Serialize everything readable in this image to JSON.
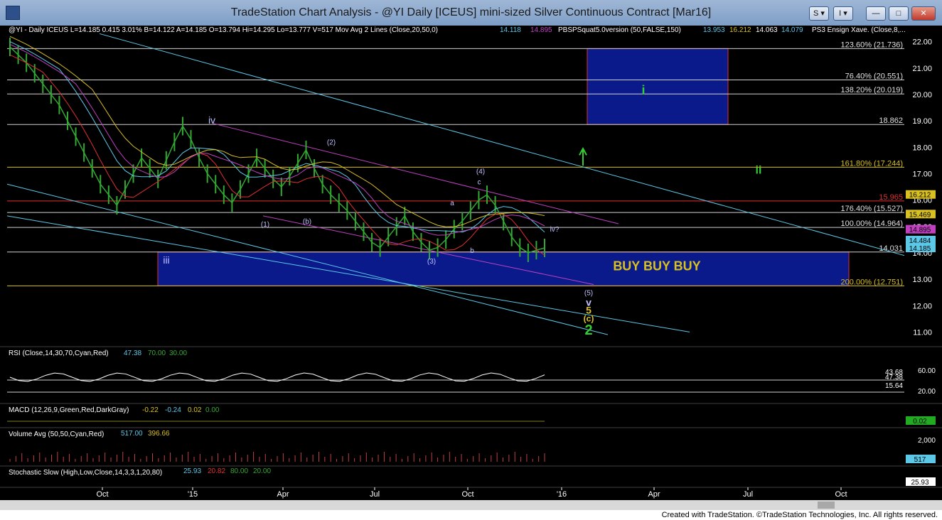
{
  "window": {
    "title": "TradeStation Chart Analysis - @YI Daily [ICEUS] mini-sized Silver Continuous Contract [Mar16]",
    "buttons": {
      "s": "S ▾",
      "i": "I ▾",
      "min": "—",
      "max": "□",
      "close": "✕"
    }
  },
  "footer": "Created with TradeStation. ©TradeStation Technologies, Inc. All rights reserved.",
  "colors": {
    "bg": "#000000",
    "bars": "#33a833",
    "cyan": "#5bc8e8",
    "magenta": "#c040c0",
    "yellow": "#d8c020",
    "red": "#e03030",
    "blue_box": "#0a1a8a",
    "green": "#22aa22"
  },
  "chart_data": {
    "type": "line",
    "title": "@YI Daily [ICEUS] mini-sized Silver Continuous Contract [Mar16]",
    "header_line": "@YI - Daily  ICEUS  L=14.185  0.415  3.01%  B=14.122  A=14.185  O=13.794  Hi=14.295  Lo=13.777  V=517  Mov Avg 2 Lines (Close,20,50,0)",
    "ma_values": [
      "14.118",
      "14.895"
    ],
    "pbs_label": "PBSPSquat5.0version (50,FALSE,150)",
    "pbs_values": [
      "13.953",
      "16.212",
      "14.063",
      "14.079"
    ],
    "ps3_label": "PS3 Ensign Xave. (Close,8,...",
    "x_ticks": [
      "Oct",
      "'15",
      "Apr",
      "Jul",
      "Oct",
      "'16",
      "Apr",
      "Jul",
      "Oct"
    ],
    "y_ticks": [
      "22.00",
      "21.00",
      "20.00",
      "19.00",
      "18.00",
      "17.00",
      "16.00",
      "15.00",
      "14.00",
      "13.00",
      "12.00",
      "11.00"
    ],
    "ylim": [
      10.5,
      22.5
    ],
    "price_points": [
      21.8,
      21.5,
      21.2,
      20.8,
      20.4,
      20.0,
      19.6,
      19.0,
      18.4,
      17.8,
      17.2,
      16.6,
      16.2,
      15.8,
      16.4,
      17.0,
      17.6,
      17.2,
      16.8,
      17.5,
      18.2,
      18.8,
      18.3,
      17.6,
      17.0,
      16.6,
      16.2,
      15.9,
      16.4,
      17.0,
      17.6,
      17.2,
      16.8,
      16.5,
      16.9,
      17.4,
      17.9,
      17.2,
      16.6,
      16.2,
      15.9,
      15.6,
      15.2,
      14.8,
      14.4,
      14.2,
      14.6,
      15.0,
      15.4,
      14.8,
      14.4,
      14.1,
      14.2,
      14.5,
      14.9,
      15.2,
      15.6,
      16.0,
      16.2,
      15.8,
      15.2,
      14.6,
      14.2,
      14.0,
      14.1,
      14.185
    ],
    "levels": [
      {
        "label": "123.60% (21.736)",
        "value": 21.736
      },
      {
        "label": "76.40% (20.551)",
        "value": 20.551
      },
      {
        "label": "138.20% (20.019)",
        "value": 20.019
      },
      {
        "label": "18.862",
        "value": 18.862
      },
      {
        "label": "161.80% (17.244)",
        "value": 17.244
      },
      {
        "label": "15.965",
        "value": 15.965
      },
      {
        "label": "176.40% (15.527)",
        "value": 15.527
      },
      {
        "label": "100.00% (14.964)",
        "value": 14.964
      },
      {
        "label": "14.031",
        "value": 14.031
      },
      {
        "label": "200.00% (12.751)",
        "value": 12.751
      }
    ],
    "right_tags": [
      {
        "label": "16.212",
        "value": 16.212,
        "color": "#d8c020"
      },
      {
        "label": "15.469",
        "value": 15.469,
        "color": "#d8c020"
      },
      {
        "label": "14.895",
        "value": 14.895,
        "color": "#c040c0"
      },
      {
        "label": "14.484",
        "value": 14.484,
        "color": "#5bc8e8"
      },
      {
        "label": "14.185",
        "value": 14.185,
        "color": "#5bc8e8"
      }
    ],
    "annotations": {
      "buy": "BUY BUY BUY",
      "iv": "iv",
      "iii": "iii",
      "i": "i",
      "ii": "ii",
      "ivq": "iv?",
      "w1": "(1)",
      "w2": "(2)",
      "w3": "(3)",
      "w4": "(4)",
      "w5": "(5)",
      "b_paren": "(b)",
      "a": "a",
      "b": "b",
      "c": "c",
      "v": "v",
      "five": "5",
      "c_paren": "(c)",
      "two": "2"
    },
    "rsi": {
      "label": "RSI (Close,14,30,70,Cyan,Red)",
      "values": [
        "47.38",
        "70.00",
        "30.00"
      ],
      "levels": [
        "43.68",
        "47.38",
        "15.64"
      ],
      "ticks": [
        "60.00",
        "20.00"
      ]
    },
    "macd": {
      "label": "MACD (12,26,9,Green,Red,DarkGray)",
      "values": [
        "-0.22",
        "-0.24",
        "0.02",
        "0.00"
      ],
      "tag": "0.02"
    },
    "volume": {
      "label": "Volume Avg (50,50,Cyan,Red)",
      "values": [
        "517.00",
        "396.66"
      ],
      "ticks": [
        "2,000"
      ],
      "tag": "517"
    },
    "stoch": {
      "label": "Stochastic Slow (High,Low,Close,14,3,3,1,20,80)",
      "values": [
        "25.93",
        "20.82",
        "80.00",
        "20.00"
      ],
      "tag": "25.93"
    }
  }
}
